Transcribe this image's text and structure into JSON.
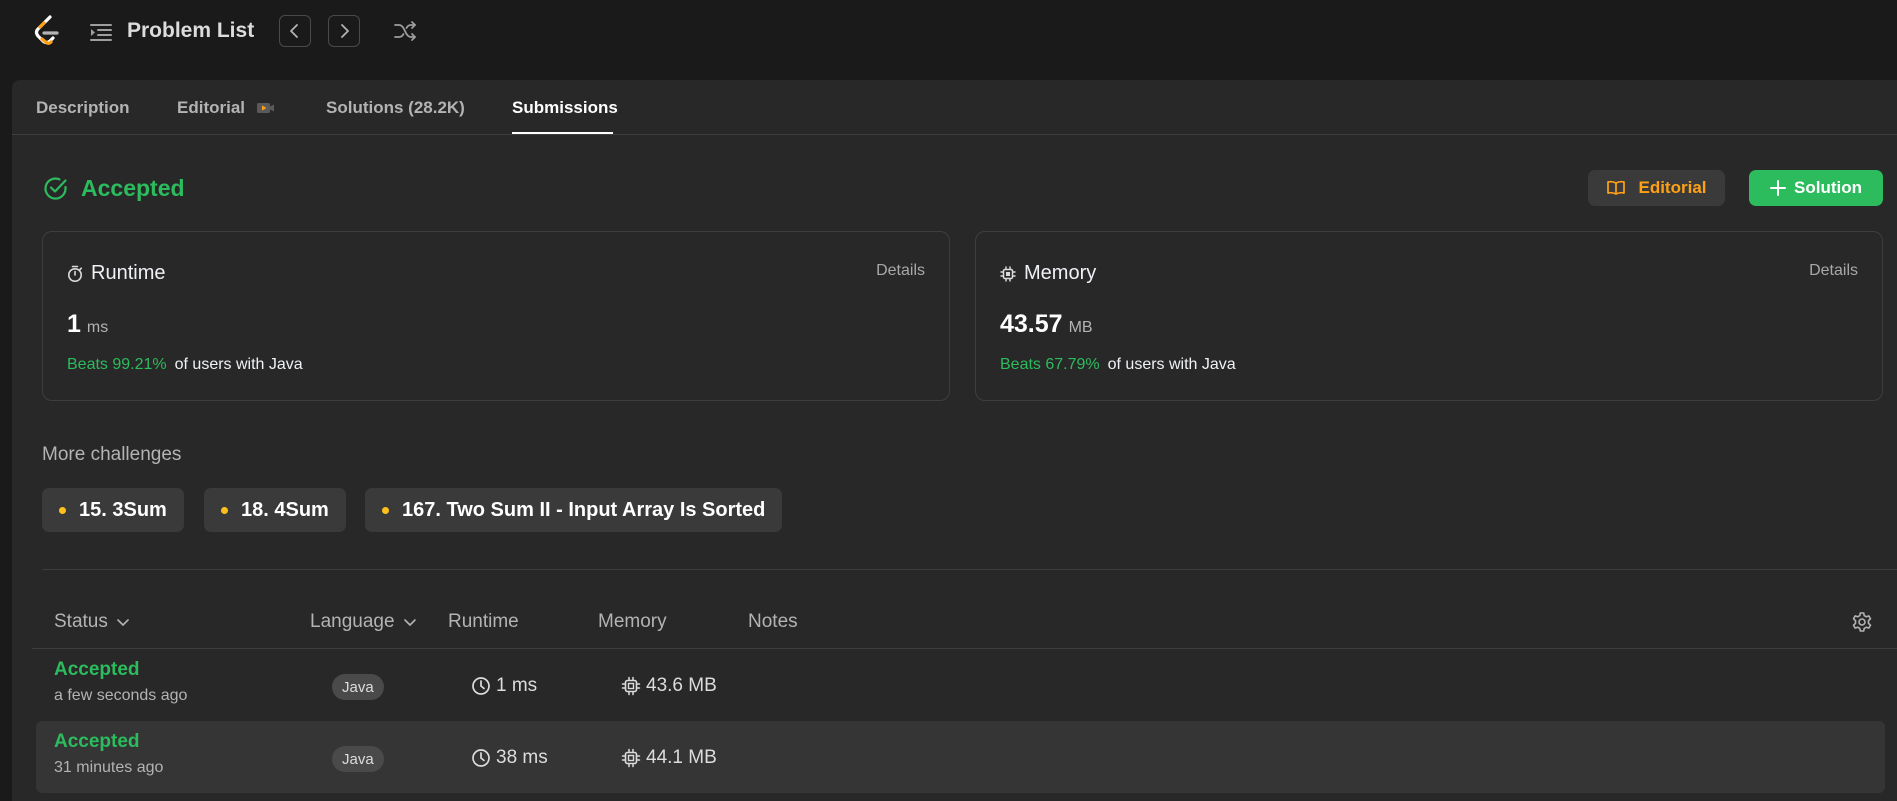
{
  "header": {
    "title": "Problem List"
  },
  "tabs": [
    {
      "label": "Description"
    },
    {
      "label": "Editorial"
    },
    {
      "label": "Solutions (28.2K)"
    },
    {
      "label": "Submissions"
    }
  ],
  "result": {
    "status": "Accepted",
    "editorial_button": "Editorial",
    "solution_button": "Solution"
  },
  "runtime_card": {
    "title": "Runtime",
    "details": "Details",
    "value": "1",
    "unit": "ms",
    "beats": "Beats 99.21%",
    "suffix": "of users with Java"
  },
  "memory_card": {
    "title": "Memory",
    "details": "Details",
    "value": "43.57",
    "unit": "MB",
    "beats": "Beats 67.79%",
    "suffix": "of users with Java"
  },
  "challenges": {
    "title": "More challenges",
    "items": [
      {
        "label": "15. 3Sum"
      },
      {
        "label": "18. 4Sum"
      },
      {
        "label": "167. Two Sum II - Input Array Is Sorted"
      }
    ]
  },
  "table": {
    "columns": {
      "status": "Status",
      "language": "Language",
      "runtime": "Runtime",
      "memory": "Memory",
      "notes": "Notes"
    },
    "rows": [
      {
        "status": "Accepted",
        "time": "a few seconds ago",
        "language": "Java",
        "runtime": "1 ms",
        "memory": "43.6 MB"
      },
      {
        "status": "Accepted",
        "time": "31 minutes ago",
        "language": "Java",
        "runtime": "38 ms",
        "memory": "44.1 MB"
      }
    ]
  },
  "colors": {
    "accepted_green": "#2cbb5d",
    "editorial_orange": "#ffa116",
    "chip_dot_yellow": "#ffc01e",
    "panel_bg": "#282828",
    "page_bg": "#1a1a1a"
  },
  "icons": [
    "leetcode-logo-icon",
    "list-icon",
    "chevron-left-icon",
    "chevron-right-icon",
    "shuffle-icon",
    "video-icon",
    "check-circle-icon",
    "book-icon",
    "plus-icon",
    "stopwatch-icon",
    "chip-icon",
    "chevron-down-icon",
    "gear-icon",
    "clock-icon"
  ]
}
